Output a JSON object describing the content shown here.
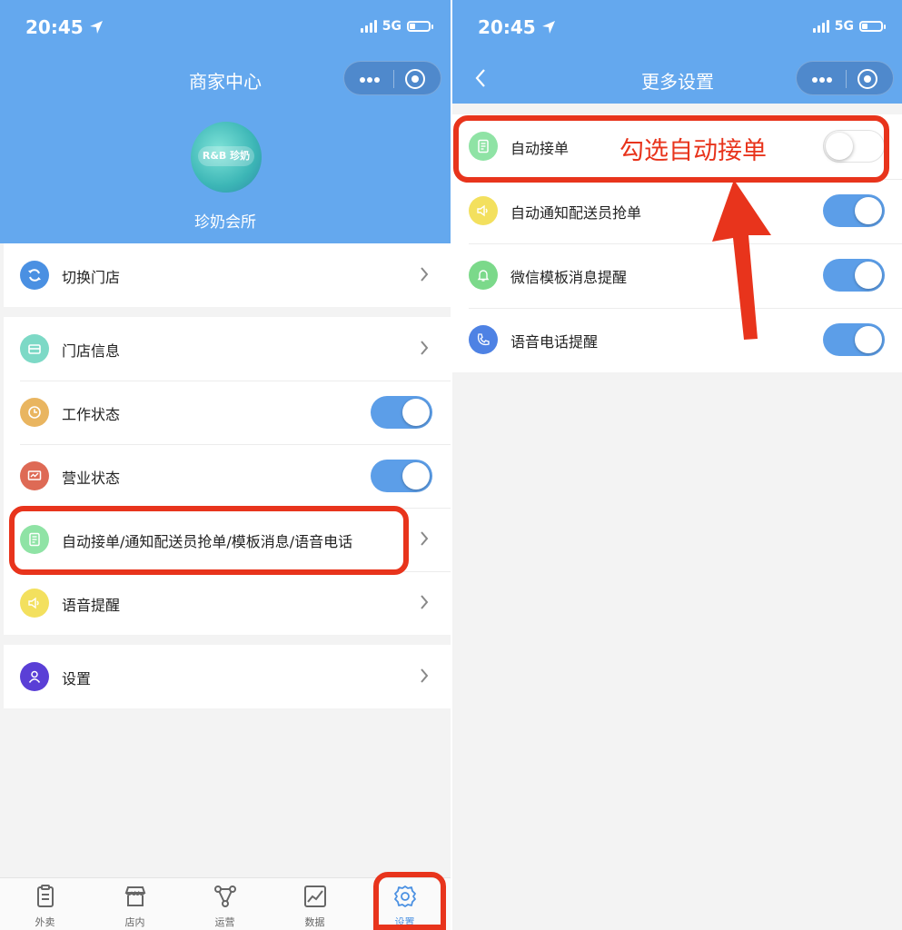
{
  "left": {
    "status": {
      "time": "20:45",
      "network": "5G"
    },
    "nav_title": "商家中心",
    "profile": {
      "store_name": "珍奶会所",
      "logo_text": "R&B 珍奶"
    },
    "switch_store": {
      "label": "切换门店"
    },
    "menu": [
      {
        "label": "门店信息",
        "control": "chevron",
        "icon": "store-icon",
        "icon_color": "#7dd9c6"
      },
      {
        "label": "工作状态",
        "control": "toggle-on",
        "icon": "clock-icon",
        "icon_color": "#e9b560"
      },
      {
        "label": "营业状态",
        "control": "toggle-on",
        "icon": "monitor-icon",
        "icon_color": "#de6a55"
      },
      {
        "label": "自动接单/通知配送员抢单/模板消息/语音电话",
        "control": "chevron",
        "icon": "order-icon",
        "icon_color": "#8fe3a5"
      },
      {
        "label": "语音提醒",
        "control": "chevron",
        "icon": "speaker-icon",
        "icon_color": "#f3e05e"
      }
    ],
    "settings": {
      "label": "设置"
    },
    "tabbar": [
      {
        "label": "外卖",
        "icon": "clipboard-icon"
      },
      {
        "label": "店内",
        "icon": "storefront-icon"
      },
      {
        "label": "运营",
        "icon": "network-icon"
      },
      {
        "label": "数据",
        "icon": "chart-icon"
      },
      {
        "label": "设置",
        "icon": "gear-icon",
        "active": true
      }
    ]
  },
  "right": {
    "status": {
      "time": "20:45",
      "network": "5G"
    },
    "nav_title": "更多设置",
    "settings": [
      {
        "label": "自动接单",
        "state": "off",
        "icon": "order-icon",
        "icon_color": "#8fe3a5"
      },
      {
        "label": "自动通知配送员抢单",
        "state": "on",
        "icon": "speaker-icon",
        "icon_color": "#f3e05e"
      },
      {
        "label": "微信模板消息提醒",
        "state": "on",
        "icon": "bell-icon",
        "icon_color": "#7bd98a"
      },
      {
        "label": "语音电话提醒",
        "state": "on",
        "icon": "phone-icon",
        "icon_color": "#4e82e4"
      }
    ],
    "annotation": "勾选自动接单"
  },
  "colors": {
    "header": "#64a8ee",
    "toggle_on": "#5c9ee8",
    "annotation_red": "#e8341c",
    "active_tab": "#4a90e2"
  }
}
